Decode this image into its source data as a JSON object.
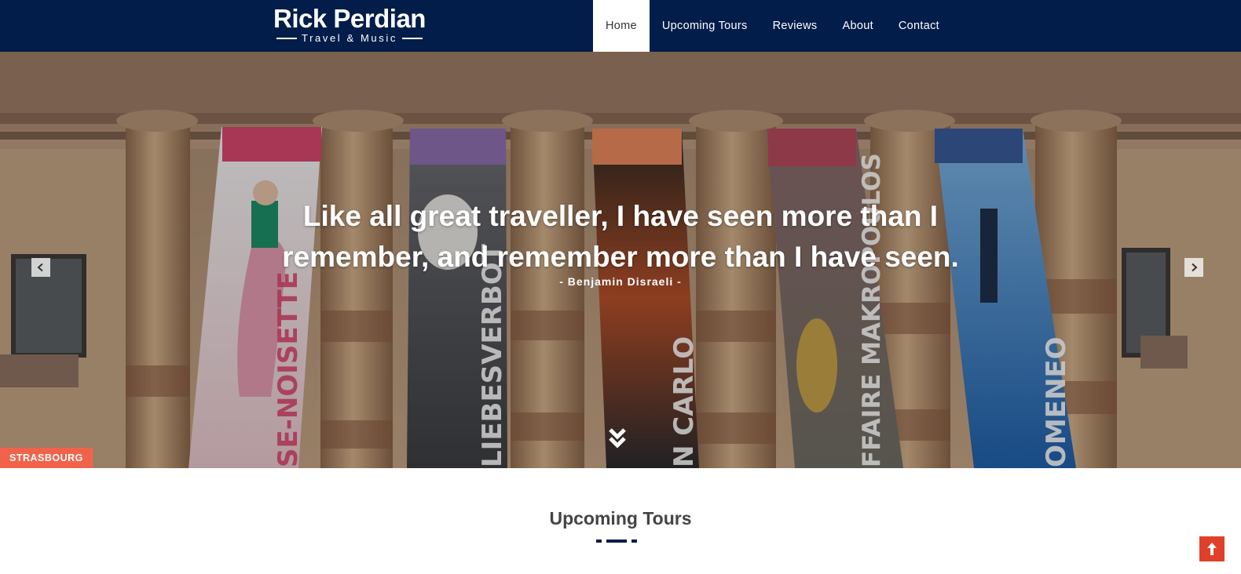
{
  "header": {
    "logo": {
      "title": "Rick Perdian",
      "tagline": "Travel & Music"
    },
    "nav": [
      {
        "label": "Home",
        "active": true
      },
      {
        "label": "Upcoming Tours"
      },
      {
        "label": "Reviews"
      },
      {
        "label": "About"
      },
      {
        "label": "Contact"
      }
    ]
  },
  "hero": {
    "quote": "Like all great traveller, I have seen more than I remember, and remember more than I have seen.",
    "author": "- Benjamin Disraeli -",
    "location": "STRASBOURG",
    "prev_icon": "chevron-left-icon",
    "next_icon": "chevron-right-icon",
    "scroll_icon": "double-chevron-down-icon",
    "banners": [
      "SE-NOISETTE",
      "LIEBESVERBOT",
      "N CARLO",
      "FFAIRE MAKROPOULOS",
      "OMENEO"
    ]
  },
  "section": {
    "title": "Upcoming Tours"
  },
  "colors": {
    "header_bg": "#031d4a",
    "badge": "#f0634a",
    "to_top": "#e0402a"
  },
  "back_to_top_icon": "arrow-up-icon"
}
